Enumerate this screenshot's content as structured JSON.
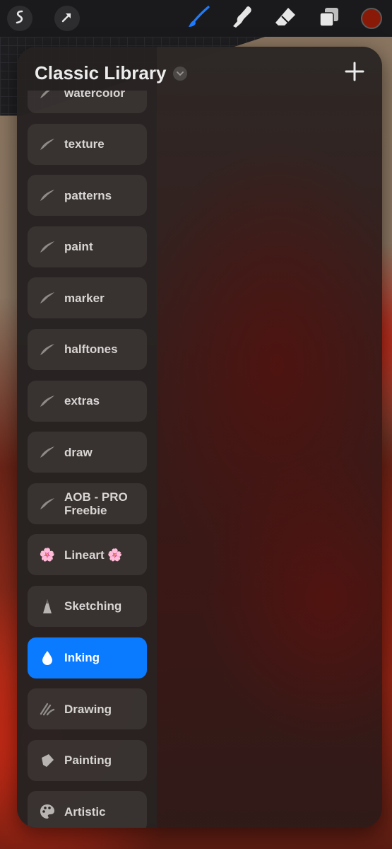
{
  "app": {
    "toolbar": {
      "actions_icon": "wrench-icon",
      "selection_icon": "cursor-arrow-icon",
      "tools": [
        {
          "name": "brush",
          "active": true
        },
        {
          "name": "smudge",
          "active": false
        },
        {
          "name": "eraser",
          "active": false
        },
        {
          "name": "layers",
          "active": false
        }
      ],
      "color": "#8a1a08"
    },
    "panel": {
      "title": "Classic Library",
      "add_label": "+",
      "items": [
        {
          "label": "watercolor",
          "icon": "brush-stroke-icon",
          "active": false
        },
        {
          "label": "texture",
          "icon": "brush-stroke-icon",
          "active": false
        },
        {
          "label": "patterns",
          "icon": "brush-stroke-icon",
          "active": false
        },
        {
          "label": "paint",
          "icon": "brush-stroke-icon",
          "active": false
        },
        {
          "label": "marker",
          "icon": "brush-stroke-icon",
          "active": false
        },
        {
          "label": "halftones",
          "icon": "brush-stroke-icon",
          "active": false
        },
        {
          "label": "extras",
          "icon": "brush-stroke-icon",
          "active": false
        },
        {
          "label": "draw",
          "icon": "brush-stroke-icon",
          "active": false
        },
        {
          "label": "AOB - PRO Freebie",
          "icon": "brush-stroke-icon",
          "active": false
        },
        {
          "label": "Lineart 🌸",
          "icon": "flower-icon",
          "active": false
        },
        {
          "label": "Sketching",
          "icon": "pencil-tip-icon",
          "active": false
        },
        {
          "label": "Inking",
          "icon": "ink-drop-icon",
          "active": true
        },
        {
          "label": "Drawing",
          "icon": "scribble-icon",
          "active": false
        },
        {
          "label": "Painting",
          "icon": "paint-brush-icon",
          "active": false
        },
        {
          "label": "Artistic",
          "icon": "palette-icon",
          "active": false
        }
      ]
    },
    "colors": {
      "accent": "#0a7aff",
      "toolbar_bg": "#1a1a1c",
      "panel_bg": "#2a2624"
    }
  }
}
